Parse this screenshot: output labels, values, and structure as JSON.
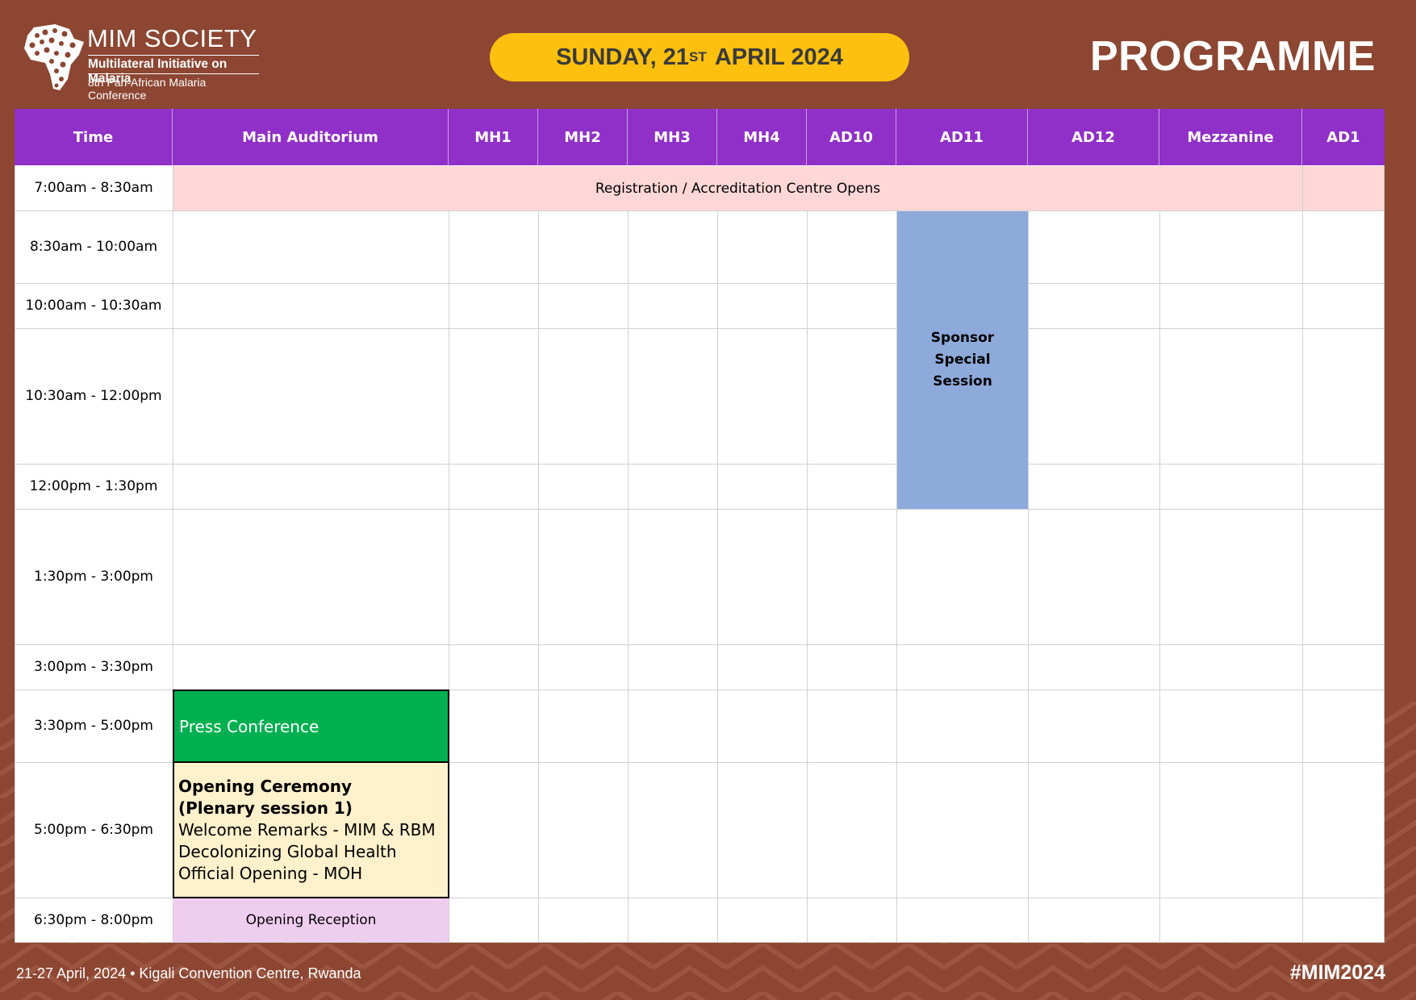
{
  "colors": {
    "background": "#8c4632",
    "header_purple": "#9030c8",
    "date_pill": "#fec00f",
    "registration": "#ffd7d7",
    "sponsor": "#8eaadb",
    "press": "#00b050",
    "opening": "#fff1cc",
    "reception": "#efcdef"
  },
  "logo": {
    "title": "MIM SOCIETY",
    "subtitle": "Multilateral Initiative on Malaria",
    "conference": "8th Pan-African Malaria Conference",
    "icon": "africa-map-icon"
  },
  "date": {
    "prefix": "SUNDAY, 21",
    "suffix": "ST",
    "rest": "APRIL 2024"
  },
  "page_title": "PROGRAMME",
  "columns": [
    "Time",
    "Main Auditorium",
    "MH1",
    "MH2",
    "MH3",
    "MH4",
    "AD10",
    "AD11",
    "AD12",
    "Mezzanine",
    "AD1"
  ],
  "times": [
    "7:00am - 8:30am",
    "8:30am - 10:00am",
    "10:00am - 10:30am",
    "10:30am - 12:00pm",
    "12:00pm - 1:30pm",
    "1:30pm - 3:00pm",
    "3:00pm - 3:30pm",
    "3:30pm - 5:00pm",
    "5:00pm - 6:30pm",
    "6:30pm - 8:00pm"
  ],
  "sessions": {
    "registration": "Registration / Accreditation Centre Opens",
    "sponsor": "Sponsor Special Session",
    "press": "Press Conference",
    "opening_title": "Opening Ceremony (Plenary session 1)",
    "opening_line1": "Welcome Remarks -  MIM & RBM",
    "opening_line2": "Decolonizing Global Health",
    "opening_line3": "Official Opening - MOH",
    "reception": "Opening Reception"
  },
  "footer": {
    "left": "21-27 April, 2024 • Kigali Convention Centre, Rwanda",
    "right": "#MIM2024"
  }
}
